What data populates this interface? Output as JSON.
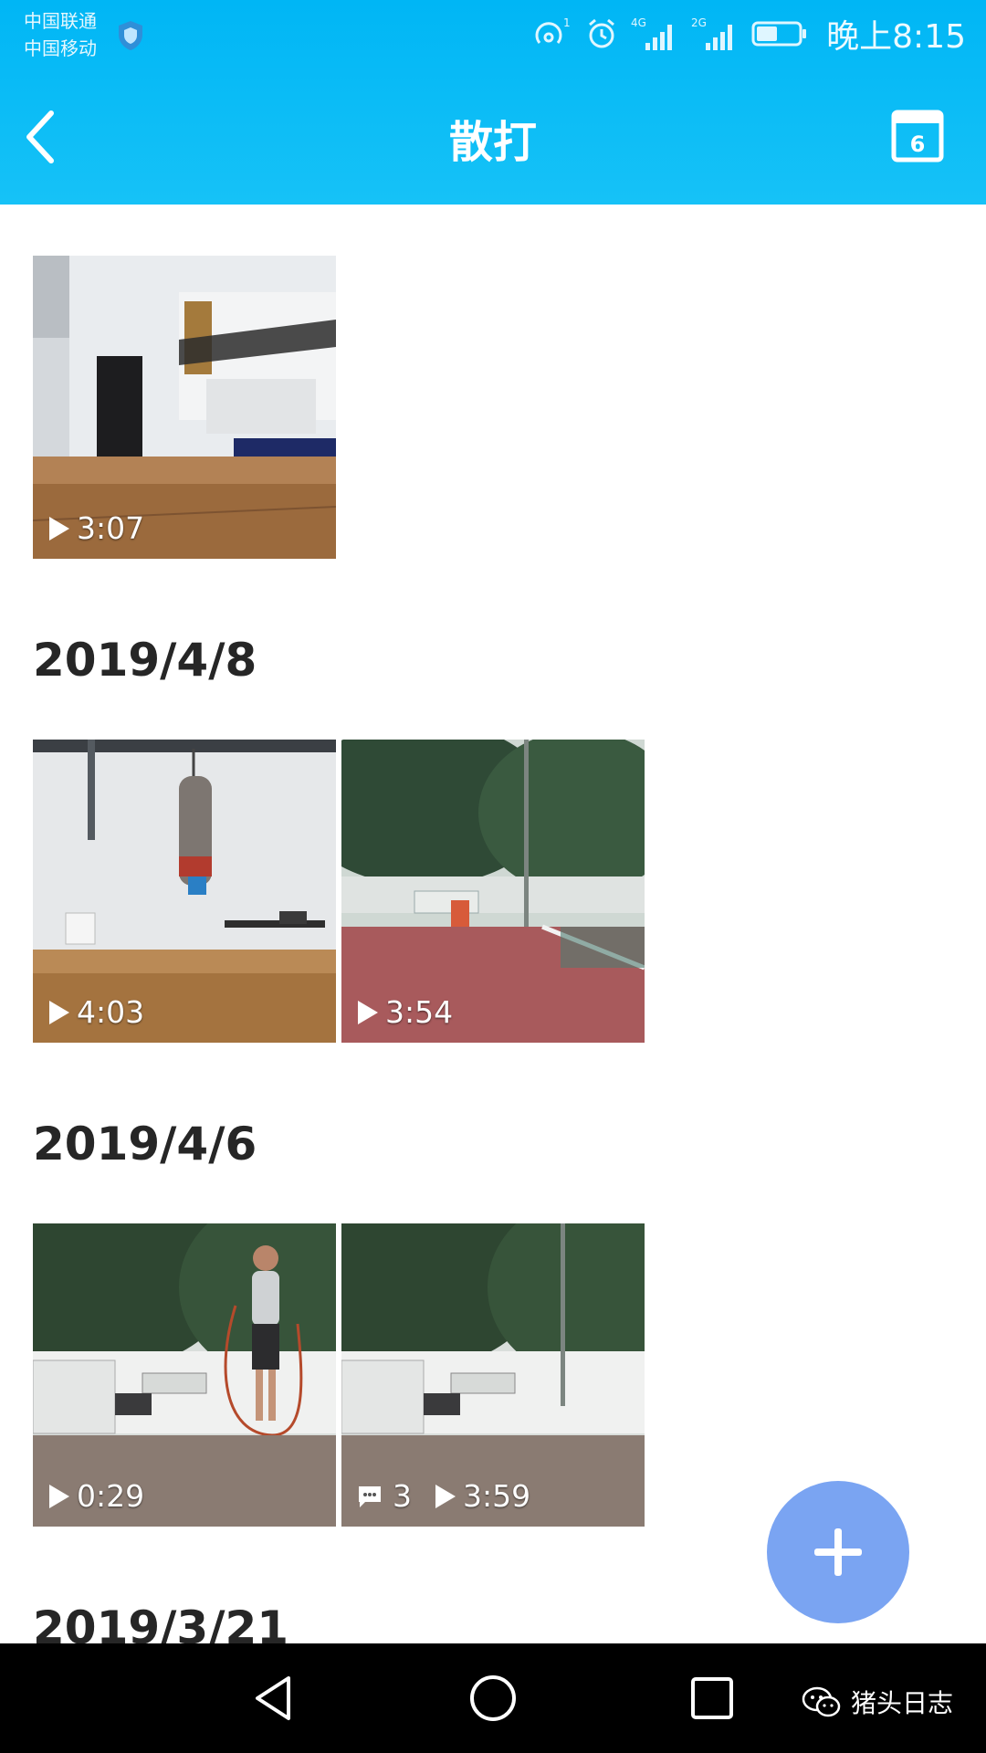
{
  "status_bar": {
    "carrier_1": "中国联通",
    "carrier_2": "中国移动",
    "network_1": "4G",
    "network_2": "2G",
    "hotspot_badge": "1",
    "time": "晚上8:15"
  },
  "header": {
    "title": "散打",
    "calendar_day": "6"
  },
  "groups": [
    {
      "date": "",
      "videos": [
        {
          "duration": "3:07",
          "comments": ""
        }
      ]
    },
    {
      "date": "2019/4/8",
      "videos": [
        {
          "duration": "4:03",
          "comments": ""
        },
        {
          "duration": "3:54",
          "comments": ""
        }
      ]
    },
    {
      "date": "2019/4/6",
      "videos": [
        {
          "duration": "0:29",
          "comments": ""
        },
        {
          "duration": "3:59",
          "comments": "3"
        }
      ]
    },
    {
      "date": "2019/3/21",
      "videos": []
    }
  ],
  "watermark": "猪头日志",
  "colors": {
    "header": "#00b6f5",
    "fab": "#7aa4f2",
    "navbar": "#000000"
  }
}
